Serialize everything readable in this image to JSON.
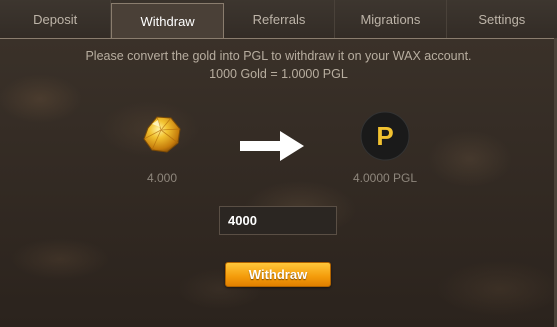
{
  "tabs": [
    {
      "label": "Deposit"
    },
    {
      "label": "Withdraw"
    },
    {
      "label": "Referrals"
    },
    {
      "label": "Migrations"
    },
    {
      "label": "Settings"
    }
  ],
  "active_tab": "Withdraw",
  "withdraw": {
    "instruction": "Please convert the gold into PGL to withdraw it on your WAX account.",
    "rate": "1000 Gold = 1.0000 PGL",
    "gold_amount": "4.000",
    "pgl_amount": "4.0000 PGL",
    "input_value": "4000",
    "button_label": "Withdraw",
    "pgl_letter": "P"
  },
  "colors": {
    "accent": "#f49b0a",
    "pgl_letter": "#f2c230",
    "pgl_circle": "#1a1a1a",
    "gold": "#e8a91c"
  },
  "icons": {
    "gold": "gold-nugget-icon",
    "arrow": "arrow-right-icon",
    "pgl": "pgl-token-icon"
  }
}
